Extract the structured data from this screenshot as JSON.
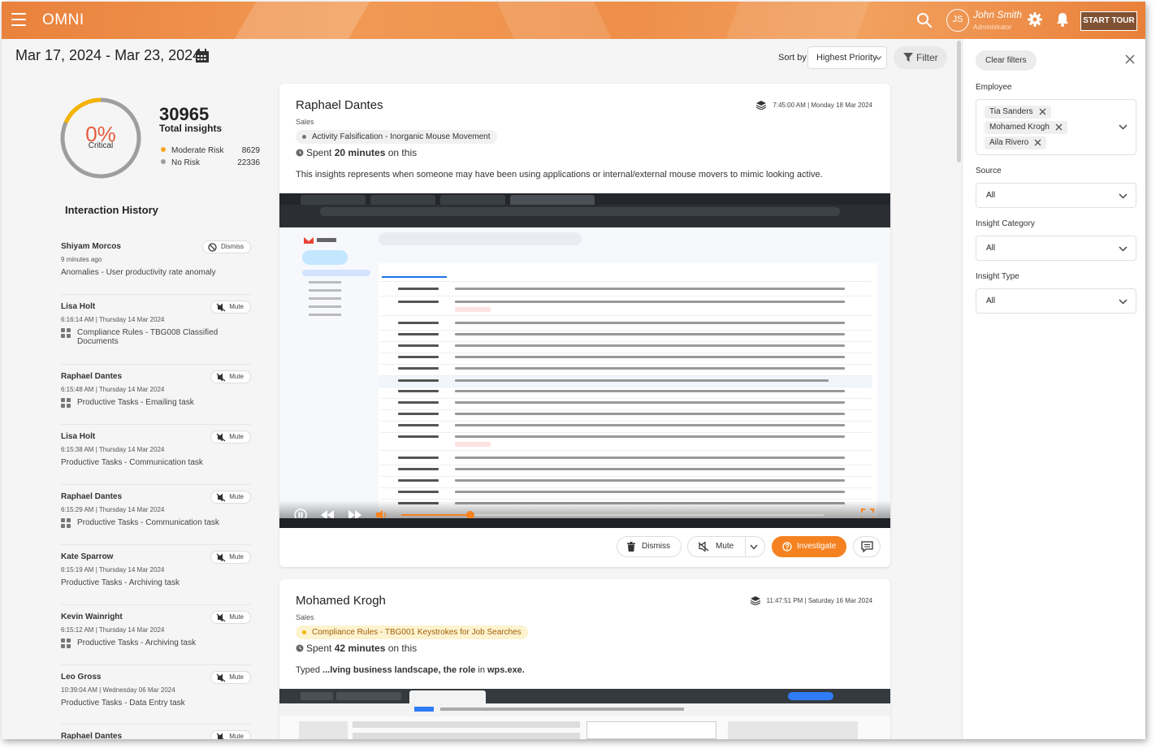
{
  "header": {
    "brand": "OMNI",
    "user_name": "John Smith",
    "user_initials": "JS",
    "user_role": "Administrator",
    "start_tour": "START TOUR"
  },
  "toolbar": {
    "date_range": "Mar 17, 2024 - Mar 23, 2024",
    "sort_label": "Sort by",
    "sort_value": "Highest Priority",
    "filter_label": "Filter"
  },
  "summary": {
    "percent": "0%",
    "percent_label": "Critical",
    "total": "30965",
    "total_label": "Total insights",
    "moderate_label": "Moderate Risk",
    "moderate_value": "8629",
    "norisk_label": "No Risk",
    "norisk_value": "22336",
    "colors": {
      "moderate": "#f5a623",
      "norisk": "#9e9e9e",
      "gauge_track": "#9e9e9e",
      "gauge_fill": "#f5b400"
    }
  },
  "history": {
    "title": "Interaction History",
    "items": [
      {
        "name": "Shiyam Morcos",
        "time": "9 minutes ago",
        "desc": "Anomalies - User productivity rate anomaly",
        "action": "Dismiss",
        "icon": false
      },
      {
        "name": "Lisa Holt",
        "time": "6:16:14 AM | Thursday 14 Mar 2024",
        "desc": "Compliance Rules - TBG008 Classified Documents",
        "action": "Mute",
        "icon": true
      },
      {
        "name": "Raphael Dantes",
        "time": "6:15:48 AM | Thursday 14 Mar 2024",
        "desc": "Productive Tasks - Emailing task",
        "action": "Mute",
        "icon": true
      },
      {
        "name": "Lisa Holt",
        "time": "6:15:38 AM | Thursday 14 Mar 2024",
        "desc": "Productive Tasks - Communication task",
        "action": "Mute",
        "icon": false
      },
      {
        "name": "Raphael Dantes",
        "time": "6:15:29 AM | Thursday 14 Mar 2024",
        "desc": "Productive Tasks - Communication task",
        "action": "Mute",
        "icon": true
      },
      {
        "name": "Kate Sparrow",
        "time": "6:15:19 AM | Thursday 14 Mar 2024",
        "desc": "Productive Tasks - Archiving task",
        "action": "Mute",
        "icon": false
      },
      {
        "name": "Kevin Wainright",
        "time": "6:15:12 AM | Thursday 14 Mar 2024",
        "desc": "Productive Tasks - Archiving task",
        "action": "Mute",
        "icon": true
      },
      {
        "name": "Leo Gross",
        "time": "10:39:04 AM | Wednesday 06 Mar 2024",
        "desc": "Productive Tasks - Data Entry task",
        "action": "Mute",
        "icon": false
      },
      {
        "name": "Raphael Dantes",
        "time": "",
        "desc": "",
        "action": "Mute",
        "icon": false
      }
    ]
  },
  "cards": [
    {
      "name": "Raphael Dantes",
      "dept": "Sales",
      "timestamp": "7:45:00 AM | Monday 18 Mar 2024",
      "tag": "Activity Falsification - Inorganic Mouse Movement",
      "spent_prefix": "Spent",
      "spent_value": "20 minutes",
      "spent_suffix": "on this",
      "desc": "This insights represents when someone may have been using applications or internal/external mouse movers to mimic looking active.",
      "actions": {
        "dismiss": "Dismiss",
        "mute": "Mute",
        "investigate": "Investigate"
      }
    },
    {
      "name": "Mohamed Krogh",
      "dept": "Sales",
      "timestamp": "11:47:51 PM | Saturday 16 Mar 2024",
      "tag": "Compliance Rules - TBG001 Keystrokes for Job Searches",
      "spent_prefix": "Spent",
      "spent_value": "42 minutes",
      "spent_suffix": "on this",
      "typed_prefix": "Typed",
      "typed_value": "...lving business landscape, the role",
      "typed_mid": "in",
      "typed_app": "wps.exe."
    }
  ],
  "filters": {
    "clear": "Clear filters",
    "employee_label": "Employee",
    "employees": [
      "Tia Sanders",
      "Mohamed Krogh",
      "Aila Rivero"
    ],
    "source_label": "Source",
    "source_value": "All",
    "category_label": "Insight Category",
    "category_value": "All",
    "type_label": "Insight Type",
    "type_value": "All"
  },
  "colors": {
    "accent": "#f08a3c",
    "investigate": "#f58220"
  }
}
